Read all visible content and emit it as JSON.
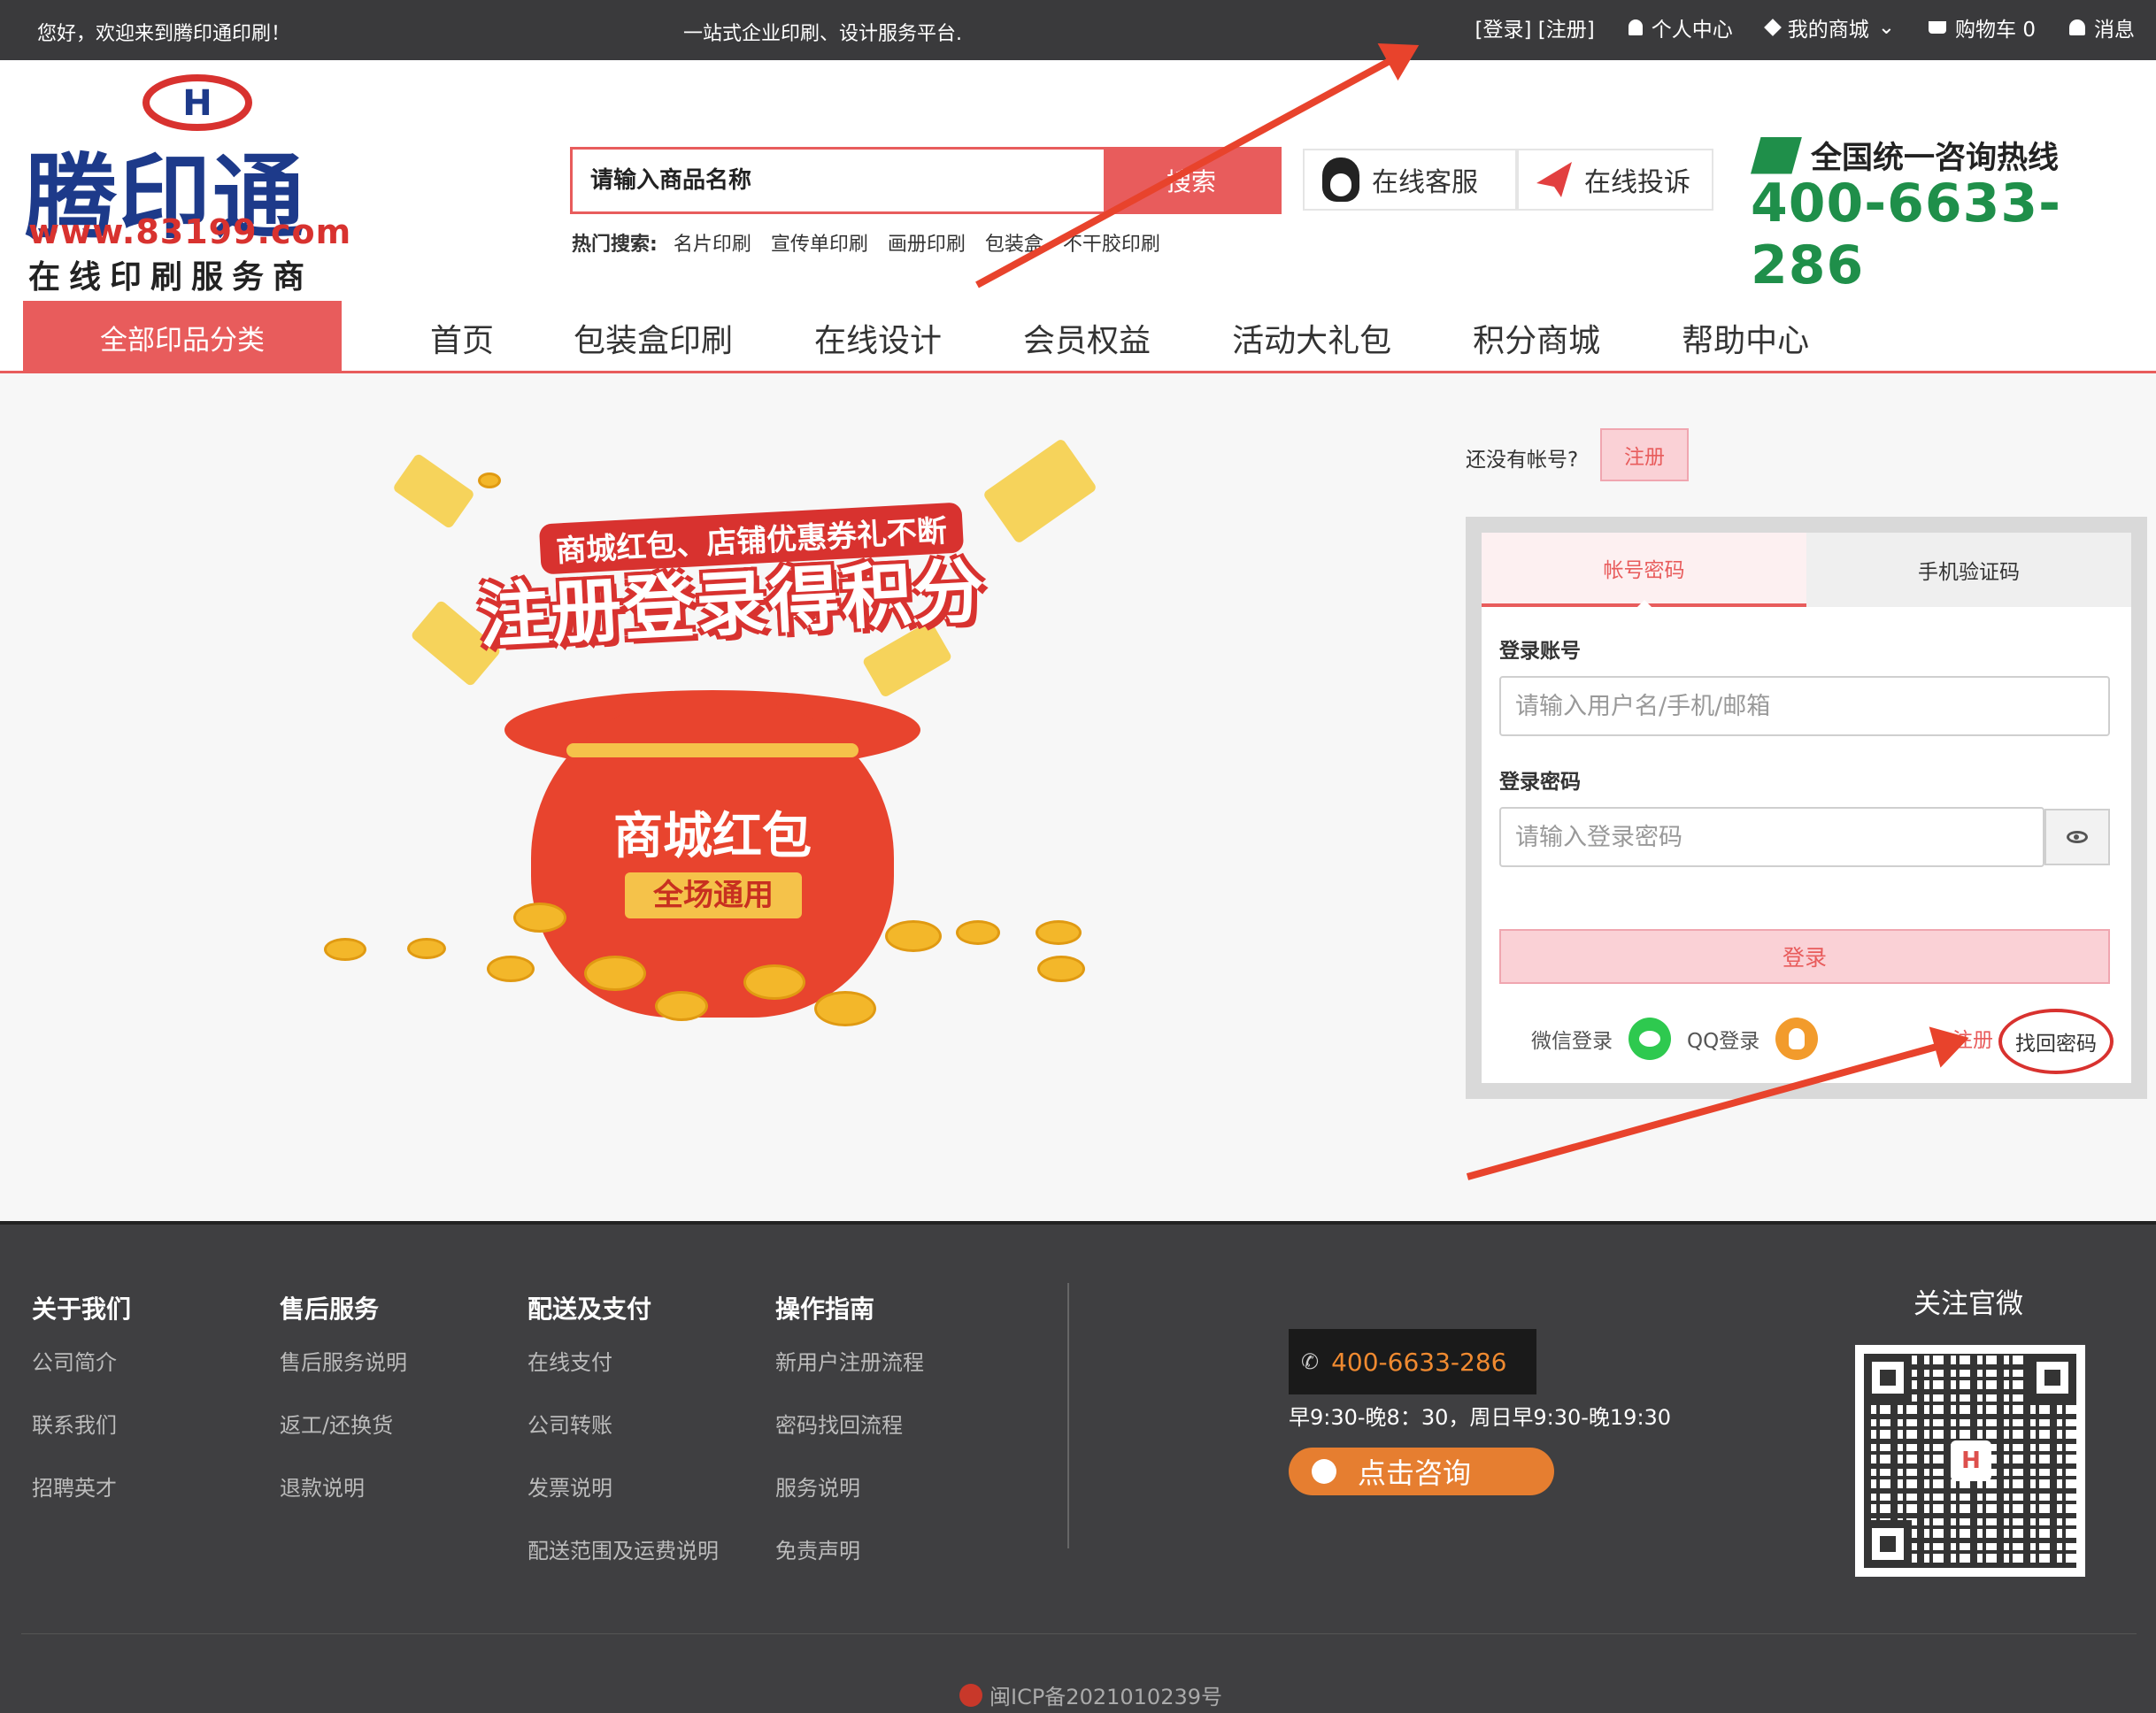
{
  "topbar": {
    "welcome": "您好，欢迎来到腾印通印刷！",
    "slogan": "一站式企业印刷、设计服务平台.",
    "login_register": "[登录] [注册]",
    "personal_center": "个人中心",
    "my_store": "我的商城",
    "cart": "购物车 0",
    "messages": "消息"
  },
  "logo": {
    "name": "腾印通",
    "url": "www.83199.com",
    "tagline": "在线印刷服务商",
    "mark": "H"
  },
  "search": {
    "placeholder": "请输入商品名称",
    "button": "搜索",
    "hot_label": "热门搜索:",
    "hot_items": [
      "名片印刷",
      "宣传单印刷",
      "画册印刷",
      "包装盒",
      "不干胶印刷"
    ]
  },
  "services": {
    "online_service": "在线客服",
    "complaint": "在线投诉"
  },
  "hotline": {
    "title": "全国统一咨询热线",
    "number": "400-6633-286"
  },
  "nav": {
    "all_categories": "全部印品分类",
    "items": [
      "首页",
      "包装盒印刷",
      "在线设计",
      "会员权益",
      "活动大礼包",
      "积分商城",
      "帮助中心"
    ]
  },
  "banner": {
    "caption_small": "商城红包、店铺优惠券礼不断",
    "caption_big": "注册登录得积分",
    "bag_title": "商城红包",
    "bag_sub": "全场通用"
  },
  "login": {
    "no_account": "还没有帐号?",
    "register_button": "注册",
    "tab_password": "帐号密码",
    "tab_sms": "手机验证码",
    "account_label": "登录账号",
    "account_placeholder": "请输入用户名/手机/邮箱",
    "password_label": "登录密码",
    "password_placeholder": "请输入登录密码",
    "submit": "登录",
    "wechat_login": "微信登录",
    "qq_login": "QQ登录",
    "register_link": "注册",
    "forgot_password": "找回密码"
  },
  "footer": {
    "columns": [
      {
        "title": "关于我们",
        "items": [
          "公司简介",
          "联系我们",
          "招聘英才"
        ]
      },
      {
        "title": "售后服务",
        "items": [
          "售后服务说明",
          "返工/还换货",
          "退款说明"
        ]
      },
      {
        "title": "配送及支付",
        "items": [
          "在线支付",
          "公司转账",
          "发票说明",
          "配送范围及运费说明"
        ]
      },
      {
        "title": "操作指南",
        "items": [
          "新用户注册流程",
          "密码找回流程",
          "服务说明",
          "免责声明"
        ]
      }
    ],
    "phone": "400-6633-286",
    "hours": "早9:30-晚8：30，周日早9:30-晚19:30",
    "consult": "点击咨询",
    "follow": "关注官微",
    "icp": "闽ICP备2021010239号"
  },
  "colors": {
    "accent": "#e85c5c",
    "topbar": "#3a3a3c",
    "footer": "#3f3f41",
    "hotline": "#1f8f4a",
    "annotation": "#e8432c"
  }
}
